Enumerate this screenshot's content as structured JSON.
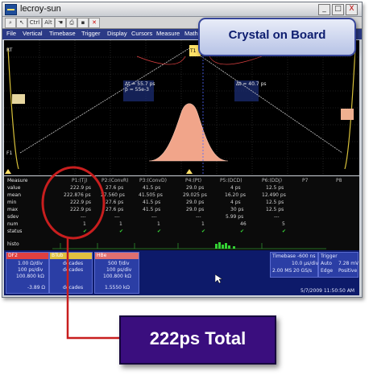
{
  "window": {
    "title": "lecroy-sun",
    "buttons": [
      "_",
      "□",
      "X"
    ]
  },
  "toolbar": {
    "items": [
      "Ctrl",
      "Alt"
    ]
  },
  "menu": [
    "File",
    "Vertical",
    "Timebase",
    "Trigger",
    "Display",
    "Cursors",
    "Measure",
    "Math"
  ],
  "callout_title": "Crystal on Board",
  "scope": {
    "cursor_left": "Δt = 55.7 ps",
    "cursor_left2": "ρ = 55e-3",
    "cursor_right": "Δt = 40.7 ps",
    "marker_top": "T1",
    "marker_left": "RT",
    "marker_left2": "F1"
  },
  "measure": {
    "row_labels": [
      "Measure",
      "value",
      "mean",
      "min",
      "max",
      "sdev",
      "num",
      "status"
    ],
    "columns": [
      {
        "name": "P1:(Tj)",
        "value": "222.9 ps",
        "mean": "222.876 ps",
        "min": "222.9 ps",
        "max": "222.9 ps",
        "sdev": "---",
        "num": "1",
        "status": "✔"
      },
      {
        "name": "P2:(ConvR)",
        "value": "27.6 ps",
        "mean": "27.560 ps",
        "min": "27.6 ps",
        "max": "27.6 ps",
        "sdev": "---",
        "num": "1",
        "status": "✔"
      },
      {
        "name": "P3:(ConvD)",
        "value": "41.5 ps",
        "mean": "41.505 ps",
        "min": "41.5 ps",
        "max": "41.5 ps",
        "sdev": "---",
        "num": "1",
        "status": "✔"
      },
      {
        "name": "P4:(Pt)",
        "value": "29.0 ps",
        "mean": "29.025 ps",
        "min": "29.0 ps",
        "max": "29.0 ps",
        "sdev": "---",
        "num": "1",
        "status": "✔"
      },
      {
        "name": "P5:(DCD)",
        "value": "4 ps",
        "mean": "16.20 ps",
        "min": "4 ps",
        "max": "30 ps",
        "sdev": "5.99 ps",
        "num": "46",
        "status": "✔"
      },
      {
        "name": "P6:(DDj)",
        "value": "12.5 ps",
        "mean": "12.490 ps",
        "min": "12.5 ps",
        "max": "12.5 ps",
        "sdev": "---",
        "num": "5",
        "status": "✔"
      },
      {
        "name": "P7",
        "value": "",
        "mean": "",
        "min": "",
        "max": "",
        "sdev": "",
        "num": "",
        "status": ""
      },
      {
        "name": "P8",
        "value": "",
        "mean": "",
        "min": "",
        "max": "",
        "sdev": "",
        "num": "",
        "status": ""
      }
    ],
    "histo_label": "histo"
  },
  "channels": [
    {
      "name": "DF2",
      "color": "#e04040",
      "lines": [
        "1.00 Ω/div",
        "100 ps/div",
        "100.800 kΩ",
        "-3.89 Ω"
      ]
    },
    {
      "name": "BTub",
      "color": "#e0c040",
      "lines": [
        "decades",
        "decades",
        "decades"
      ]
    },
    {
      "name": "HBe",
      "color": "#e07070",
      "lines": [
        "500 f/div",
        "100 ps/div",
        "100.800 kΩ",
        "1.5550 kΩ"
      ]
    }
  ],
  "timebase": {
    "label": "Timebase",
    "offset": "-600 ns",
    "l1": "10.0 μs/div",
    "l2": "2.00 MS",
    "l3": "20 GS/s"
  },
  "trigger": {
    "label": "Trigger",
    "l1": "Auto",
    "l1v": "7.28 mV",
    "l2": "Edge",
    "l2v": "Positive"
  },
  "date": "5/7/2009 11:50:50 AM",
  "total_label": "222ps Total",
  "colors": {
    "callout_text": "#0d1d6f",
    "total_bg": "#3a0e7e",
    "ring": "#c81e1e",
    "histogram": "#f1a58a"
  }
}
